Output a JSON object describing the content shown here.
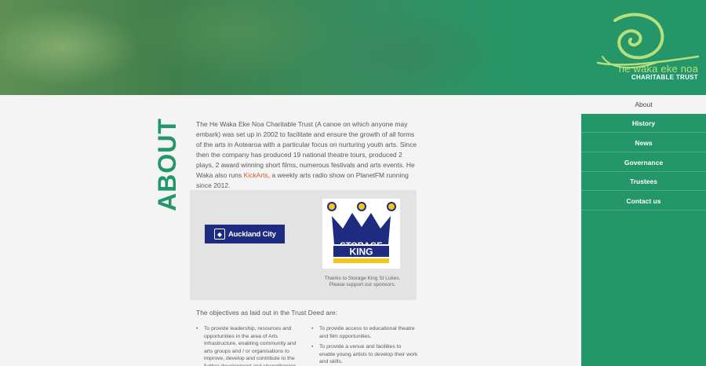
{
  "brand": {
    "title": "he waka eke noa",
    "subtitle": "CHARITABLE TRUST",
    "colors": {
      "green": "#23976a",
      "light_green": "#b7e07a",
      "link": "#d05a2a"
    }
  },
  "page": {
    "heading": "ABOUT",
    "intro_before_link": "The He Waka Eke Noa Charitable Trust (A canoe on which anyone may embark) was set up in 2002 to facilitate and ensure the growth of all forms of the arts in Aotearoa with a particular focus on nurturing youth arts. Since then the company has produced 19 national theatre tours, produced 2 plays, 2 award winning short films, numerous festivals and arts events. He Waka also runs ",
    "intro_link": "KickArts",
    "intro_after_link": ", a weekly arts radio show on PlanetFM running since 2012."
  },
  "sponsors": {
    "auckland_label": "Auckland City",
    "storage_line1": "STORAGE",
    "storage_line2": "KING",
    "caption_line1": "Thanks to Storage King St Lukes.",
    "caption_line2": "Please support our sponsors."
  },
  "objectives": {
    "heading": "The objectives as laid out in the Trust Deed are:",
    "col1": [
      "To provide leadership, resources and opportunities in the area of Arts Infrastructure, enabling community and arts groups and / or organisations to improve, develop and contribute to the further development and strengthening"
    ],
    "col2": [
      "To provide access to educational theatre and film opportunities.",
      "To provide a venue and facilities to enable young artists to develop their work and skills."
    ]
  },
  "nav": {
    "items": [
      {
        "label": "About"
      },
      {
        "label": "History"
      },
      {
        "label": "News"
      },
      {
        "label": "Governance"
      },
      {
        "label": "Trustees"
      },
      {
        "label": "Contact us"
      }
    ]
  }
}
